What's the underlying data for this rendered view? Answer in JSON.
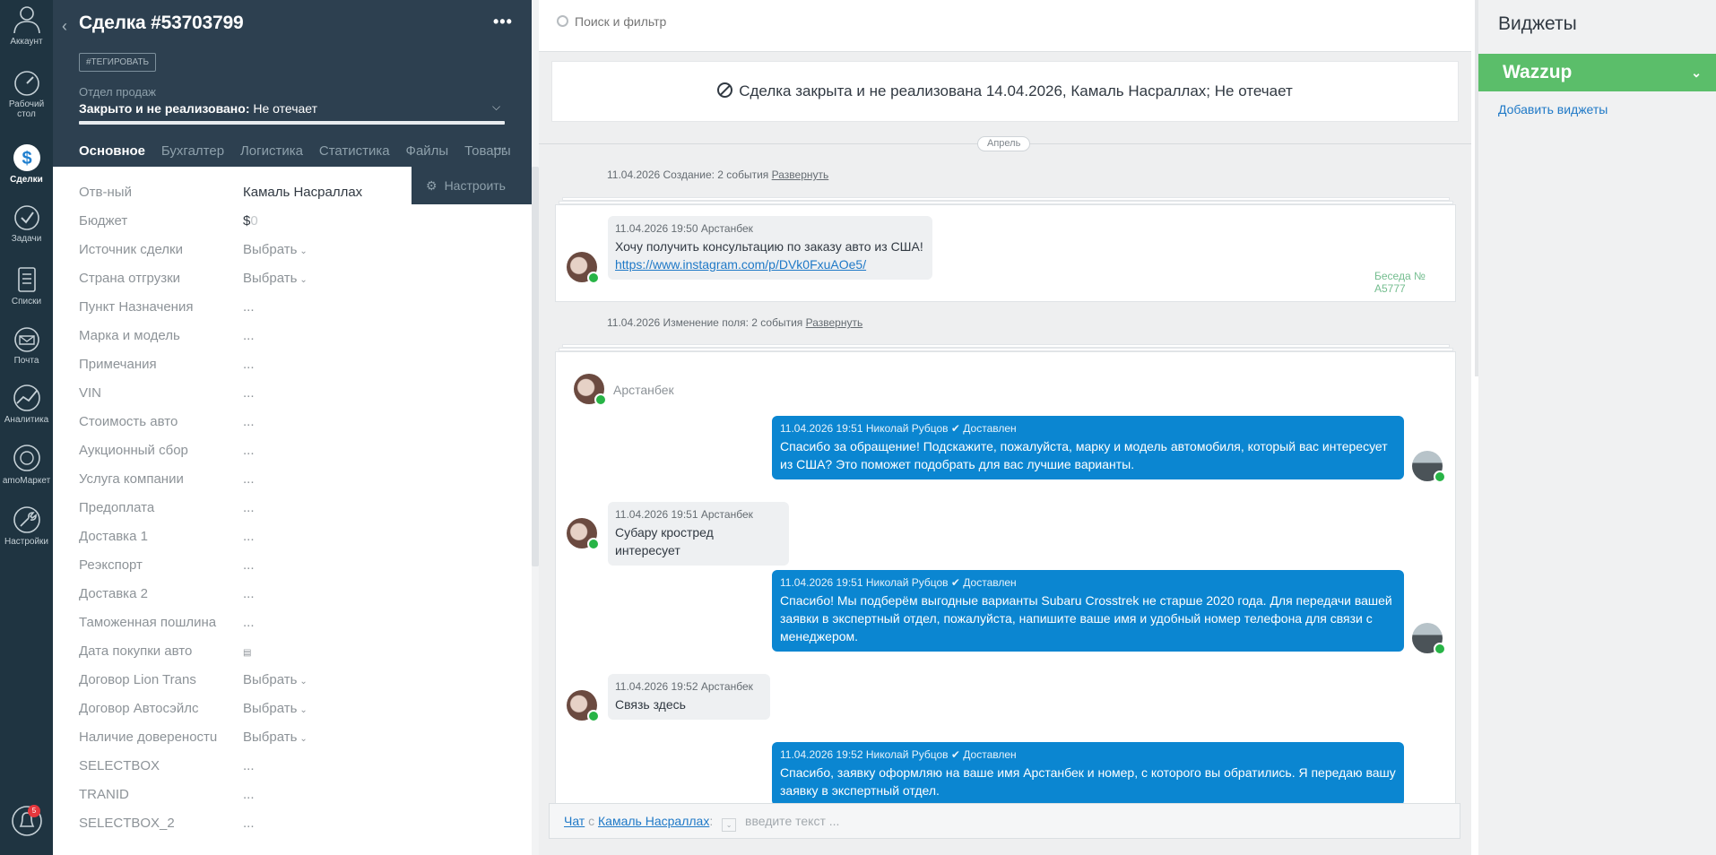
{
  "nav": {
    "account": "Аккаунт",
    "desktop": "Рабочий стол",
    "deals": "Сделки",
    "tasks": "Задачи",
    "lists": "Списки",
    "mail": "Почта",
    "analytics": "Аналитика",
    "market": "amoМаркет",
    "settings": "Настройки",
    "notifications_count": "5"
  },
  "card": {
    "title": "Сделка #53703799",
    "tag_button": "#ТЕГИРОВАТЬ",
    "pipeline_label": "Отдел продаж",
    "status_bold": "Закрыто и не реализовано:",
    "status_reason": " Не отечает",
    "tabs": [
      "Основное",
      "Бухгалтер",
      "Логистика",
      "Статистика",
      "Файлы",
      "Товары"
    ],
    "configure": "Настроить",
    "fields": [
      {
        "label": "Отв-ный",
        "value": "Камаль Насраллах"
      },
      {
        "label": "Бюджет",
        "value": "$",
        "suffix": "0"
      },
      {
        "label": "Источник сделки",
        "value": "Выбрать"
      },
      {
        "label": "Страна отгрузки",
        "value": "Выбрать"
      },
      {
        "label": "Пункт Назначения",
        "value": "..."
      },
      {
        "label": "Марка и модель",
        "value": "..."
      },
      {
        "label": "Примечания",
        "value": "..."
      },
      {
        "label": "VIN",
        "value": "..."
      },
      {
        "label": "Стоимость авто",
        "value": "..."
      },
      {
        "label": "Аукционный сбор",
        "value": "..."
      },
      {
        "label": "Услуга компании",
        "value": "..."
      },
      {
        "label": "Предоплата",
        "value": "..."
      },
      {
        "label": "Доставка 1",
        "value": "..."
      },
      {
        "label": "Реэкспорт",
        "value": "..."
      },
      {
        "label": "Доставка 2",
        "value": "..."
      },
      {
        "label": "Таможенная пошлина",
        "value": "..."
      },
      {
        "label": "Дата покупки авто",
        "value": ""
      },
      {
        "label": "Договор Lion Trans",
        "value": "Выбрать"
      },
      {
        "label": "Договор Автосэйлс",
        "value": "Выбрать"
      },
      {
        "label": "Наличие довереностu",
        "value": "Выбрать"
      },
      {
        "label": "SELECTBOX",
        "value": "..."
      },
      {
        "label": "TRANID",
        "value": "..."
      },
      {
        "label": "SELECTBOX_2",
        "value": "..."
      }
    ]
  },
  "feed": {
    "search_placeholder": "Поиск и фильтр",
    "closed_banner": "Сделка закрыта и не реализована 14.04.2026, Камаль Насраллах; Не отечает",
    "month": "Апрель",
    "event1": "11.04.2026 Создание: 2 события",
    "event2": "11.04.2026 Изменение поля: 2 события",
    "expand": "Развернуть",
    "conversation_no": "Беседа № A5777",
    "author": "Арстанбек",
    "status_delivered": "✔ Доставлен",
    "messages": [
      {
        "meta": "11.04.2026 19:50 Арстанбек",
        "text": "Хочу получить консультацию по заказу авто из США!",
        "link": "https://www.instagram.com/p/DVk0FxuAOe5/"
      },
      {
        "meta": "11.04.2026 19:51 Николай Рубцов",
        "text": "Спасибо за обращение! Подскажите, пожалуйста, марку и модель автомобиля, который вас интересует из США? Это поможет подобрать для вас лучшие варианты."
      },
      {
        "meta": "11.04.2026 19:51 Арстанбек",
        "text": "Субару кростред интересует"
      },
      {
        "meta": "11.04.2026 19:51 Николай Рубцов",
        "text": "Спасибо! Мы подберём выгодные варианты Subaru Crosstrek не старше 2020 года. Для передачи вашей заявки в экспертный отдел, пожалуйста, напишите ваше имя и удобный номер телефона для связи с менеджером."
      },
      {
        "meta": "11.04.2026 19:52 Арстанбек",
        "text": "Связь здесь"
      },
      {
        "meta": "11.04.2026 19:52 Николай Рубцов",
        "text": "Спасибо, заявку оформляю на ваше имя Арстанбек и номер, с которого вы обратились. Я передаю вашу заявку в экспертный отдел."
      }
    ],
    "chat_input": {
      "chat": "Чат",
      "with": "с",
      "contact": "Камаль Насраллах",
      "colon": ":",
      "placeholder": "введите текст ..."
    }
  },
  "widgets": {
    "title": "Виджеты",
    "wazzup": "Wazzup",
    "add": "Добавить виджеты"
  },
  "colors": {
    "nav_bg": "#1f3441",
    "card_header": "#2d4050",
    "outgoing_bubble": "#0b86d1",
    "wazzup_green": "#5bbe6a",
    "link": "#1f79c7"
  }
}
